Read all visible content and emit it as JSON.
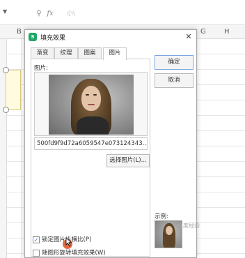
{
  "formula_bar": {
    "fx_label": "fx",
    "cell_value": "小\\"
  },
  "columns": [
    "B",
    "G",
    "H"
  ],
  "dialog": {
    "title": "填充效果",
    "tabs": [
      {
        "label": "渐变",
        "active": false
      },
      {
        "label": "纹理",
        "active": false
      },
      {
        "label": "图案",
        "active": false
      },
      {
        "label": "图片",
        "active": true
      }
    ],
    "picture_label": "图片:",
    "picture_name": "500fd9f9d72a6059547e073124343...",
    "choose_picture_button": "选择图片(L)...",
    "lock_aspect_checkbox": {
      "label": "锁定图片纵横比(P)",
      "checked": true
    },
    "rotate_with_shape_checkbox": {
      "label": "随图形旋转填充效果(W)",
      "checked": false
    },
    "ok_button": "确定",
    "cancel_button": "取消",
    "sample_label": "示例:"
  },
  "watermark": "百度经验",
  "colors": {
    "app_icon": "#1fa765",
    "primary_border": "#7aa6e0",
    "cursor_marker": "#e05a2a"
  }
}
